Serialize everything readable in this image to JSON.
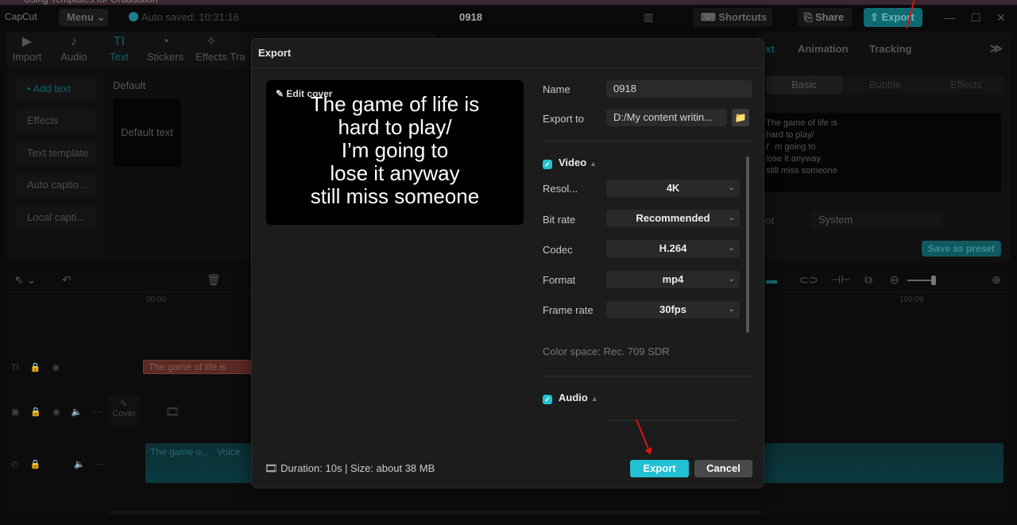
{
  "browser_tab": {
    "title": "Using Templates for Graduation",
    "close": "×",
    "new": "+"
  },
  "titlebar": {
    "logo": "CapCut",
    "menu": "Menu",
    "autosave": "Auto saved: 10:31:16",
    "project_name": "0918",
    "layout_icon": "▥",
    "shortcuts": "Shortcuts",
    "share": "Share",
    "export": "Export",
    "minimize": "—",
    "maximize": "☐",
    "close": "✕"
  },
  "toolbar": [
    {
      "label": "Import",
      "icon": "▶"
    },
    {
      "label": "Audio",
      "icon": "♪"
    },
    {
      "label": "Text",
      "icon": "TI"
    },
    {
      "label": "Stickers",
      "icon": "◔"
    },
    {
      "label": "Effects",
      "icon": "✧"
    },
    {
      "label": "Tra",
      "icon": ""
    }
  ],
  "leftnav": [
    "• Add text",
    "Effects",
    "Text template",
    "Auto captio...",
    "Local capti..."
  ],
  "library": {
    "heading": "Default",
    "card": "Default text"
  },
  "rightpanel": {
    "tabs": [
      "ext",
      "Animation",
      "Tracking",
      "≫"
    ],
    "segments": [
      "Basic",
      "Bubble",
      "Effects"
    ],
    "text_content": "The game of life is\nhard to play/\nI'  m going to\nlose it anyway\nstill miss someone",
    "font_label": "ont",
    "font_value": "System",
    "save_preset": "Save as preset"
  },
  "timeline": {
    "ruler": [
      "00:00",
      "100:08"
    ],
    "text_clip": "The game of life is",
    "cover": "Cover",
    "audio_clip": "The game o...",
    "voice_label": "Voice"
  },
  "export_dialog": {
    "title": "Export",
    "edit_cover": "Edit cover",
    "cover_text": "The game of life is\nhard to play/\nI’m going to\nlose it anyway\nstill miss someone",
    "name_label": "Name",
    "name_value": "0918",
    "export_to_label": "Export to",
    "export_to_value": "D:/My content writin...",
    "video_section": "Video",
    "video_checked": true,
    "settings": [
      {
        "label": "Resol...",
        "value": "4K"
      },
      {
        "label": "Bit rate",
        "value": "Recommended"
      },
      {
        "label": "Codec",
        "value": "H.264"
      },
      {
        "label": "Format",
        "value": "mp4"
      },
      {
        "label": "Frame rate",
        "value": "30fps"
      }
    ],
    "color_space": "Color space: Rec. 709 SDR",
    "audio_section": "Audio",
    "audio_checked": true,
    "footer_info": "Duration: 10s | Size: about 38 MB",
    "export_button": "Export",
    "cancel_button": "Cancel"
  },
  "colors": {
    "accent": "#22c0d2",
    "annotation_arrow": "#e01010"
  }
}
